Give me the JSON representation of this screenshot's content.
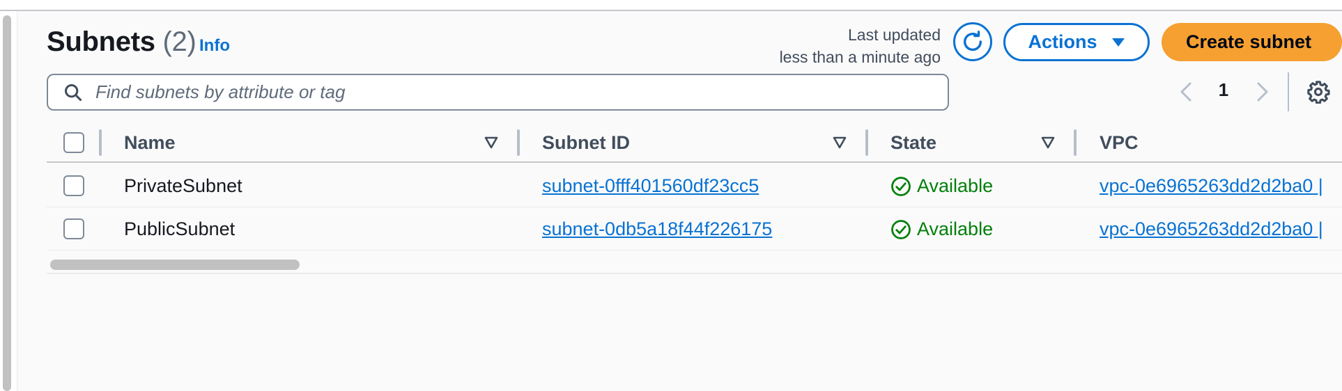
{
  "header": {
    "title": "Subnets",
    "count": "(2)",
    "info_label": "Info",
    "last_updated_line1": "Last updated",
    "last_updated_line2": "less than a minute ago",
    "actions_label": "Actions",
    "create_label": "Create subnet"
  },
  "search": {
    "placeholder": "Find subnets by attribute or tag",
    "value": ""
  },
  "pagination": {
    "current_page": "1"
  },
  "table": {
    "columns": [
      "Name",
      "Subnet ID",
      "State",
      "VPC"
    ],
    "rows": [
      {
        "name": "PrivateSubnet",
        "subnet_id": "subnet-0fff401560df23cc5",
        "state": "Available",
        "vpc": "vpc-0e6965263dd2d2ba0 |"
      },
      {
        "name": "PublicSubnet",
        "subnet_id": "subnet-0db5a18f44f226175",
        "state": "Available",
        "vpc": "vpc-0e6965263dd2d2ba0 |"
      }
    ]
  },
  "colors": {
    "link": "#0972d3",
    "primary_button": "#f5a030",
    "status_available": "#037f0c"
  },
  "icons": {
    "search": "search-icon",
    "refresh": "refresh-icon",
    "dropdown": "caret-down-icon",
    "prev": "chevron-left-icon",
    "next": "chevron-right-icon",
    "settings": "gear-icon",
    "sort": "sort-triangle-icon",
    "status": "check-circle-icon"
  }
}
